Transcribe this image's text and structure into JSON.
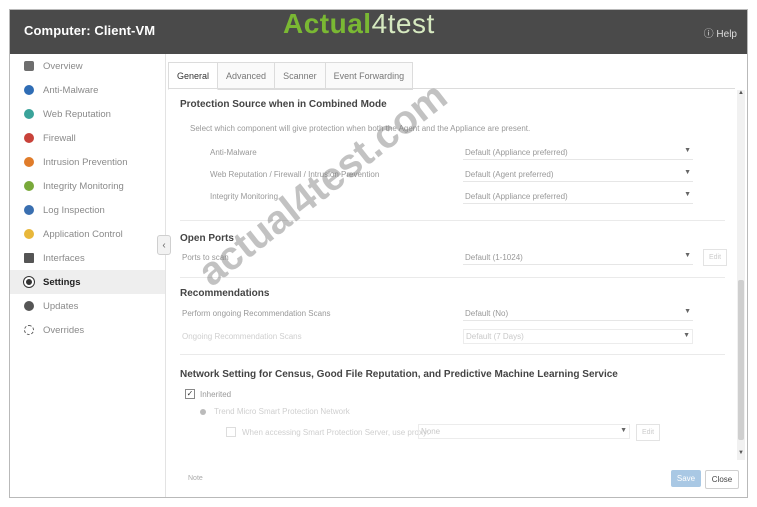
{
  "window": {
    "title": "Computer: Client-VM",
    "help_label": "ⓘ Help",
    "brand_watermark_a": "Actual",
    "brand_watermark_b": "4test"
  },
  "sidebar": {
    "items": [
      {
        "label": "Overview",
        "icon": "gear-icon",
        "color": "#6e6e6e"
      },
      {
        "label": "Anti-Malware",
        "icon": "shield-icon",
        "color": "#2f6db5"
      },
      {
        "label": "Web Reputation",
        "icon": "globe-icon",
        "color": "#3aa39a"
      },
      {
        "label": "Firewall",
        "icon": "firewall-icon",
        "color": "#c8423a"
      },
      {
        "label": "Intrusion Prevention",
        "icon": "intrusion-icon",
        "color": "#e07c2a"
      },
      {
        "label": "Integrity Monitoring",
        "icon": "integrity-icon",
        "color": "#79a93a"
      },
      {
        "label": "Log Inspection",
        "icon": "log-icon",
        "color": "#3a6fb0"
      },
      {
        "label": "Application Control",
        "icon": "app-control-icon",
        "color": "#e8b73a"
      },
      {
        "label": "Interfaces",
        "icon": "interfaces-icon",
        "color": "#555555"
      },
      {
        "label": "Settings",
        "icon": "settings-icon",
        "color": "#333333"
      },
      {
        "label": "Updates",
        "icon": "updates-icon",
        "color": "#555555"
      },
      {
        "label": "Overrides",
        "icon": "overrides-icon",
        "color": "#555555"
      }
    ],
    "active_index": 9
  },
  "tabs": [
    "General",
    "Advanced",
    "Scanner",
    "Event Forwarding"
  ],
  "active_tab": 0,
  "protection": {
    "heading": "Protection Source when in Combined Mode",
    "description": "Select which component will give protection when both the Agent and the Appliance are present.",
    "rows": [
      {
        "label": "Anti-Malware",
        "value": "Default (Appliance preferred)"
      },
      {
        "label": "Web Reputation / Firewall / Intrusion Prevention",
        "value": "Default (Agent preferred)"
      },
      {
        "label": "Integrity Monitoring",
        "value": "Default (Appliance preferred)"
      }
    ]
  },
  "open_ports": {
    "heading": "Open Ports",
    "label": "Ports to scan",
    "value": "Default (1-1024)",
    "button": "Edit"
  },
  "recommendations": {
    "heading": "Recommendations",
    "row1_label": "Perform ongoing Recommendation Scans",
    "row1_value": "Default (No)",
    "row2_label": "Ongoing Recommendation Scans",
    "row2_value": "Default (7 Days)"
  },
  "network": {
    "heading": "Network Setting for Census, Good File Reputation, and Predictive Machine Learning Service",
    "check_label": "Inherited",
    "radio_label": "Trend Micro Smart Protection Network",
    "proxy_label": "When accessing Smart Protection Server, use proxy:",
    "proxy_value": "None",
    "edit_button": "Edit"
  },
  "footer": {
    "note": "Note",
    "save_label": "Save",
    "close_label": "Close"
  },
  "diagonal_watermark": "actual4test.com"
}
